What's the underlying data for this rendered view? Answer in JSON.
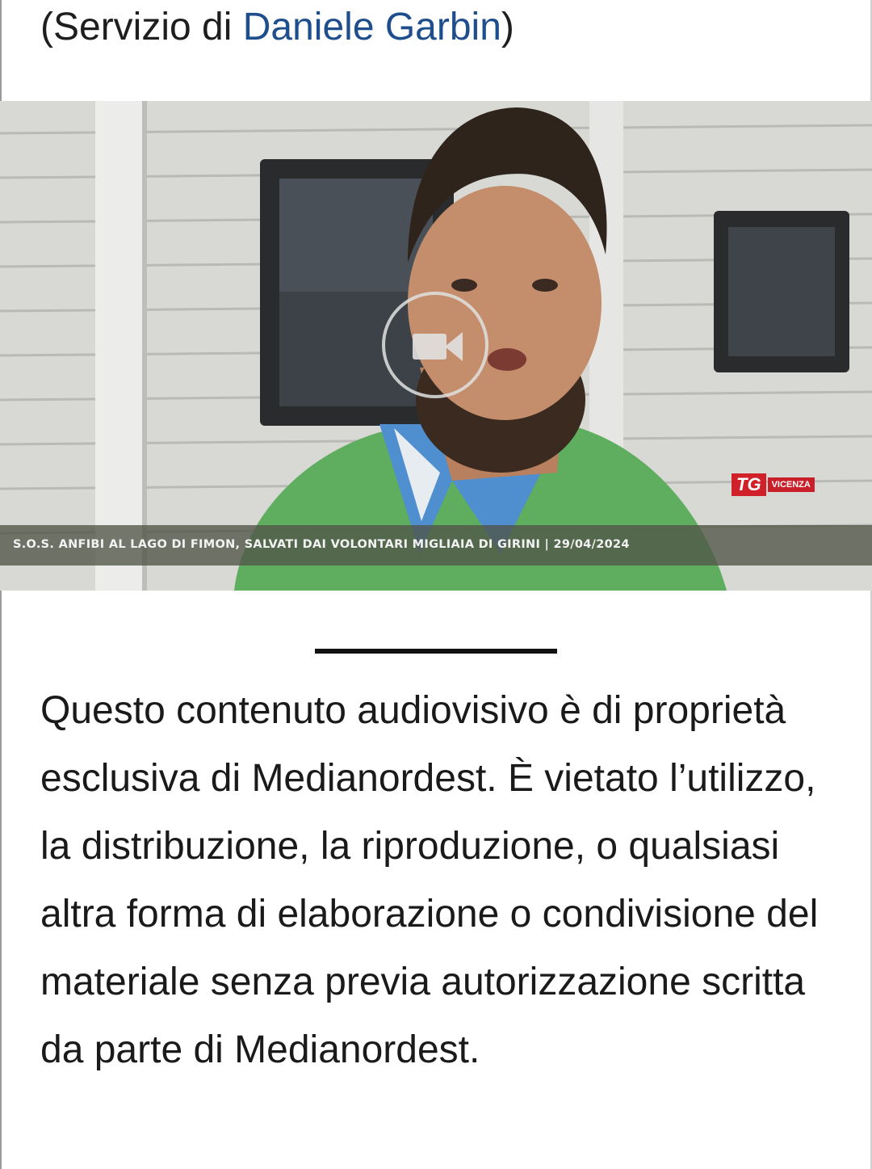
{
  "article": {
    "credit_prefix": "(Servizio di ",
    "credit_author": "Daniele Garbin",
    "credit_suffix": ")"
  },
  "video": {
    "caption": "S.O.S. ANFIBI AL LAGO DI FIMON, SALVATI DAI VOLONTARI MIGLIAIA DI GIRINI | 29/04/2024",
    "logo_tg": "TG",
    "logo_city": "VICENZA",
    "play_icon": "video-camera-icon"
  },
  "disclaimer": {
    "text": "Questo contenuto audiovisivo è di proprietà esclusiva di Medianordest. È vietato l’utilizzo, la distribuzione, la riproduzione, o qualsiasi altra forma di elaborazione o condivisione del materiale senza previa autorizzazione scritta da parte di Medianordest."
  },
  "colors": {
    "link": "#1f4e8c",
    "text": "#1a1a1a",
    "logo_red": "#d0202a"
  }
}
